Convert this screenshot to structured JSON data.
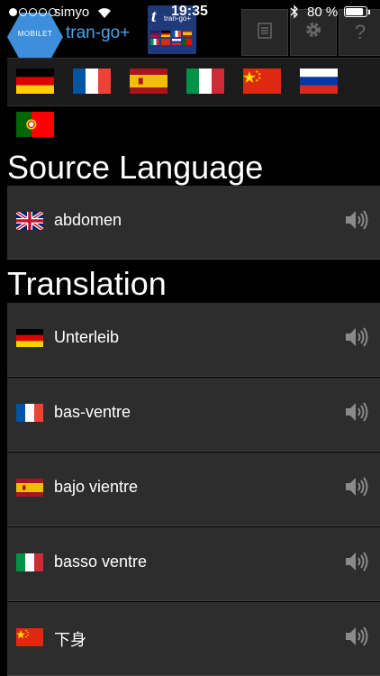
{
  "status_bar": {
    "carrier": "simyo",
    "time": "19:35",
    "battery_text": "80 %",
    "battery_level": 0.8,
    "signal_dots_filled": 1,
    "signal_dots_total": 5
  },
  "header": {
    "logo_text": "MOBILET",
    "app_name": "tran-go+",
    "app_icon_letter": "t",
    "app_icon_label": "tran-go+",
    "toolbar": {
      "list_icon": "list-icon",
      "settings_icon": "gear-icon",
      "help_icon": "?"
    }
  },
  "languages": [
    {
      "code": "de",
      "flag": "germany-flag"
    },
    {
      "code": "fr",
      "flag": "france-flag"
    },
    {
      "code": "es",
      "flag": "spain-flag"
    },
    {
      "code": "it",
      "flag": "italy-flag"
    },
    {
      "code": "zh",
      "flag": "china-flag"
    },
    {
      "code": "ru",
      "flag": "russia-flag"
    },
    {
      "code": "pt",
      "flag": "portugal-flag"
    }
  ],
  "source": {
    "title": "Source Language",
    "word": "abdomen",
    "flag": "uk-flag"
  },
  "translation": {
    "title": "Translation",
    "items": [
      {
        "flag": "germany-flag",
        "word": "Unterleib"
      },
      {
        "flag": "france-flag",
        "word": "bas-ventre"
      },
      {
        "flag": "spain-flag",
        "word": "bajo vientre"
      },
      {
        "flag": "italy-flag",
        "word": "basso ventre"
      },
      {
        "flag": "china-flag",
        "word": "下身"
      }
    ]
  },
  "colors": {
    "background": "#000000",
    "row_background": "#2d2d2d",
    "app_name": "#4aa3e8",
    "speaker": "#8a8a8a"
  }
}
